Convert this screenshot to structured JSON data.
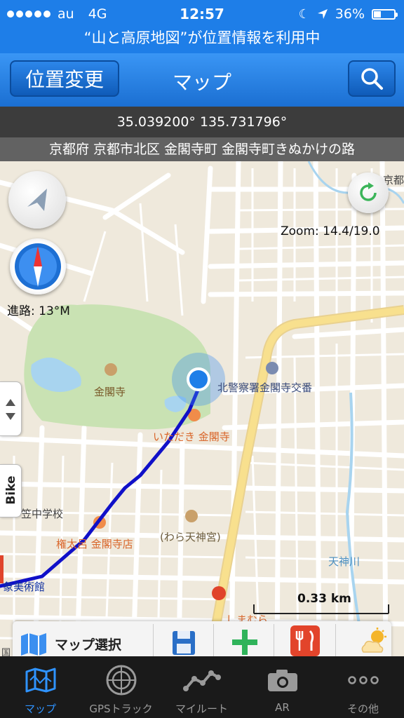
{
  "status_bar": {
    "carrier": "au",
    "network": "4G",
    "time": "12:57",
    "battery": "36%",
    "battery_level": 0.36
  },
  "location_banner": "“山と高原地図”が位置情報を利用中",
  "nav": {
    "left_button": "位置変更",
    "title": "マップ"
  },
  "coordinates": "35.039200° 135.731796°",
  "address": "京都府 京都市北区 金閣寺町 金閣寺町きぬかけの路",
  "map": {
    "zoom": "Zoom: 14.4/19.0",
    "heading": "進路: 13°M",
    "scale": "0.33 km",
    "side_tab": "Bike",
    "labels": {
      "kinkakuji": "金閣寺",
      "police": "北警察署金閣寺交番",
      "idaki": "いただき 金閣寺",
      "school": "笠中学校",
      "gontaro": "権太呂 金閣寺店",
      "waraten": "(わら天神宮)",
      "tenjin_river": "天神川",
      "shimamura": "しまむら",
      "museum": "象美術館",
      "kyo": "京都",
      "koku": "国"
    }
  },
  "toolbar": {
    "map_select": "マップ選択"
  },
  "tabs": [
    {
      "label": "マップ",
      "icon": "map-icon",
      "active": true
    },
    {
      "label": "GPSトラック",
      "icon": "gps-track-icon",
      "active": false
    },
    {
      "label": "マイルート",
      "icon": "my-route-icon",
      "active": false
    },
    {
      "label": "AR",
      "icon": "camera-icon",
      "active": false
    },
    {
      "label": "その他",
      "icon": "more-icon",
      "active": false
    }
  ],
  "colors": {
    "ios_blue": "#1e7ee8",
    "track": "#1010c8",
    "park": "#c9e2b3",
    "water": "#a8d4ef",
    "tab_active": "#2f93ff",
    "main_road": "#f8e08e"
  }
}
